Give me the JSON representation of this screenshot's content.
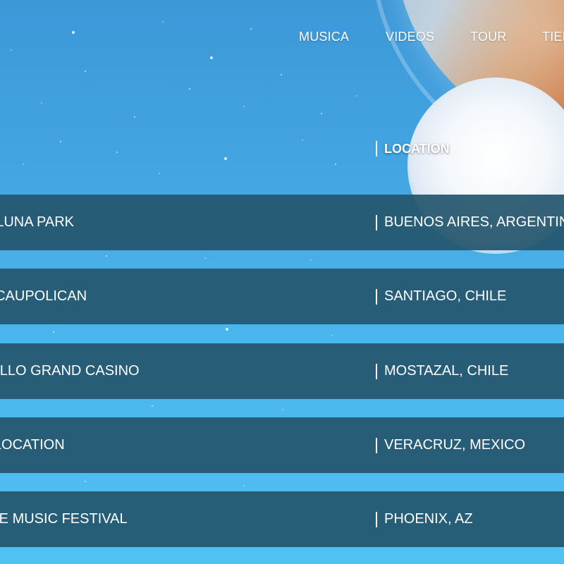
{
  "nav": {
    "items": [
      {
        "label": "MUSICA"
      },
      {
        "label": "VIDEOS"
      },
      {
        "label": "TOUR"
      },
      {
        "label": "TIEN"
      }
    ]
  },
  "table": {
    "location_header": "LOCATION",
    "rows": [
      {
        "venue": "M LUNA PARK",
        "location": "BUENOS AIRES, ARGENTIN"
      },
      {
        "venue": "O CAUPOLICAN",
        "location": "SANTIAGO, CHILE"
      },
      {
        "venue": "CELLO GRAND CASINO",
        "location": "MOSTAZAL, CHILE"
      },
      {
        "venue": "E LOCATION",
        "location": "VERACRUZ, MEXICO"
      },
      {
        "venue": "AKE MUSIC FESTIVAL",
        "location": "PHOENIX, AZ"
      }
    ]
  },
  "colors": {
    "sky_top": "#3d98d8",
    "sky_bottom": "#50c0f2",
    "row_background": "#25566e",
    "planet_orange": "#c76a2c",
    "text": "#ffffff"
  }
}
